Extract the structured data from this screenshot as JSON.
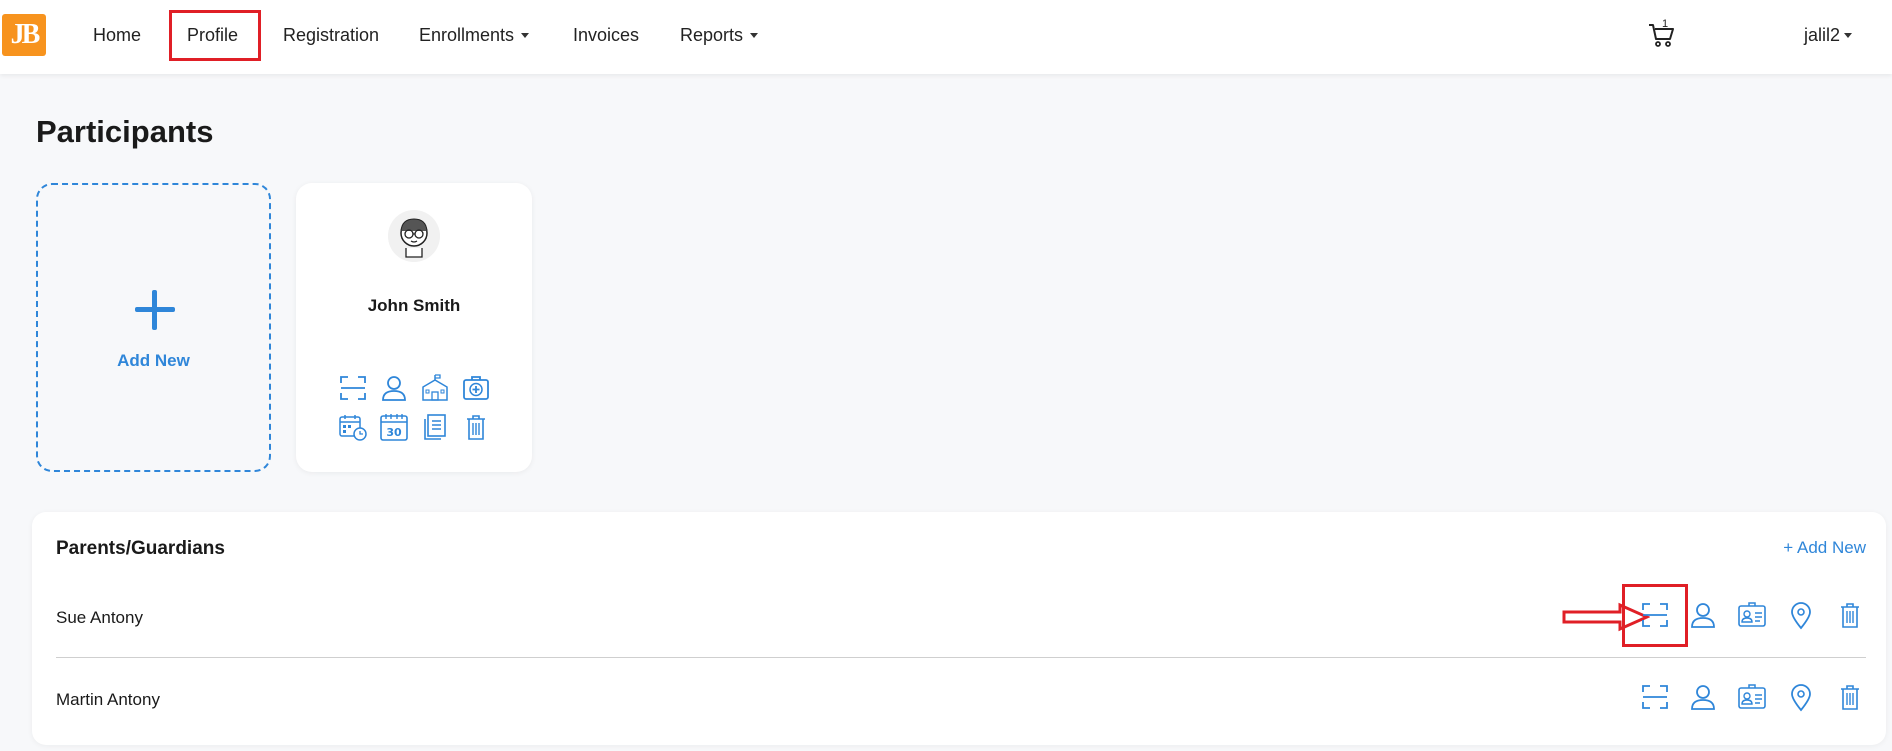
{
  "nav": {
    "logo_text": "JB",
    "items": [
      {
        "label": "Home",
        "dropdown": false
      },
      {
        "label": "Profile",
        "dropdown": false,
        "highlighted": true
      },
      {
        "label": "Registration",
        "dropdown": false
      },
      {
        "label": "Enrollments",
        "dropdown": true
      },
      {
        "label": "Invoices",
        "dropdown": false
      },
      {
        "label": "Reports",
        "dropdown": true
      }
    ],
    "cart_count": "1",
    "user": "jalil2"
  },
  "page_title": "Participants",
  "add_new_card": {
    "label": "Add New"
  },
  "participant": {
    "name": "John Smith",
    "icons": [
      "scan-icon",
      "user-icon",
      "school-icon",
      "medical-kit-icon",
      "calendar-clock-icon",
      "calendar-30-icon",
      "documents-icon",
      "trash-icon"
    ]
  },
  "guardians": {
    "title": "Parents/Guardians",
    "add_label": "+ Add New",
    "rows": [
      {
        "name": "Sue Antony",
        "icons": [
          "scan-icon",
          "user-icon",
          "id-card-icon",
          "location-icon",
          "trash-icon"
        ]
      },
      {
        "name": "Martin Antony",
        "icons": [
          "scan-icon",
          "user-icon",
          "id-card-icon",
          "location-icon",
          "trash-icon"
        ]
      }
    ]
  },
  "colors": {
    "accent": "#2f86d9",
    "logo": "#f7931e",
    "highlight": "#e01f26"
  }
}
